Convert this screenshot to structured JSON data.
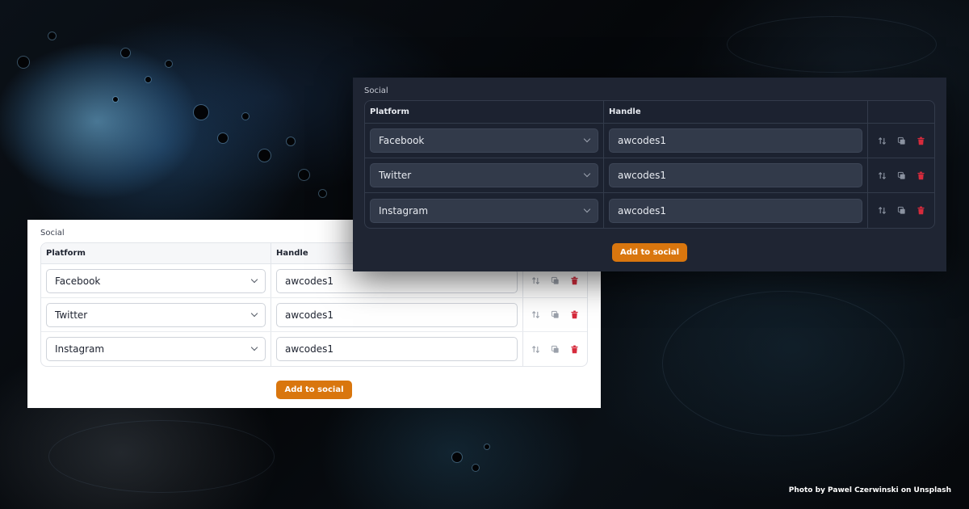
{
  "photo_credit": "Photo by Pawel Czerwinski on Unsplash",
  "light_panel": {
    "title": "Social",
    "headers": {
      "platform": "Platform",
      "handle": "Handle"
    },
    "rows": [
      {
        "platform": "Facebook",
        "handle": "awcodes1"
      },
      {
        "platform": "Twitter",
        "handle": "awcodes1"
      },
      {
        "platform": "Instagram",
        "handle": "awcodes1"
      }
    ],
    "add_label": "Add to social"
  },
  "dark_panel": {
    "title": "Social",
    "headers": {
      "platform": "Platform",
      "handle": "Handle"
    },
    "rows": [
      {
        "platform": "Facebook",
        "handle": "awcodes1"
      },
      {
        "platform": "Twitter",
        "handle": "awcodes1"
      },
      {
        "platform": "Instagram",
        "handle": "awcodes1"
      }
    ],
    "add_label": "Add to social"
  },
  "icons": {
    "reorder": "arrows-up-down-icon",
    "clone": "duplicate-icon",
    "delete": "trash-icon",
    "dropdown": "chevron-down-icon"
  },
  "colors": {
    "accent": "#d9760e",
    "danger": "#d62b3c",
    "dark_panel_bg": "#1f2533",
    "light_panel_bg": "#ffffff"
  }
}
